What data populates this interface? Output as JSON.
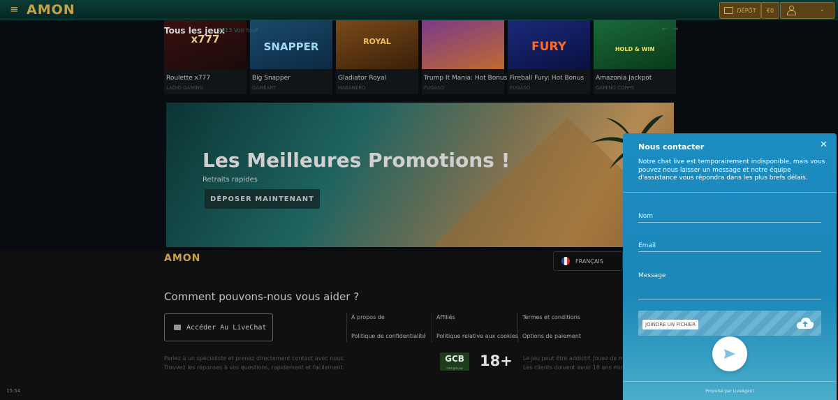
{
  "header": {
    "logo": "AMON",
    "depot_label": "DÉPÔT",
    "balance": "€0"
  },
  "games_section": {
    "title": "Tous les jeux",
    "count_label": "2613 Voir tout",
    "games": [
      {
        "name": "Roulette x777",
        "provider": "LADIO GAMING",
        "thumb_text": "x777",
        "color1": "#3a1010",
        "color2": "#1a0a0a",
        "text_color": "#e8d090"
      },
      {
        "name": "Big Snapper",
        "provider": "GAMEART",
        "thumb_text": "SNAPPER",
        "color1": "#1a4a6a",
        "color2": "#0c2a44",
        "text_color": "#9fd8f5"
      },
      {
        "name": "Gladiator Royal",
        "provider": "HABANERO",
        "thumb_text": "ROYAL",
        "color1": "#7a4a1a",
        "color2": "#3a2008",
        "text_color": "#f0c060"
      },
      {
        "name": "Trump It Mania: Hot Bonus",
        "provider": "FUGASO",
        "thumb_text": "",
        "color1": "#7a3a8a",
        "color2": "#c06a30",
        "text_color": "#ffd060"
      },
      {
        "name": "Fireball Fury: Hot Bonus",
        "provider": "FUGASO",
        "thumb_text": "FURY",
        "color1": "#1a2a7a",
        "color2": "#0a1040",
        "text_color": "#ff6a20"
      },
      {
        "name": "Amazonia Jackpot",
        "provider": "GAMING CORPS",
        "thumb_text": "HOLD & WIN",
        "color1": "#1a6a3a",
        "color2": "#0a3a1a",
        "text_color": "#f0e060"
      }
    ]
  },
  "promo": {
    "title": "Les Meilleures Promotions !",
    "subtitle": "Retraits rapides",
    "button": "DÉPOSER MAINTENANT"
  },
  "footer": {
    "logo": "AMON",
    "language": "FRANÇAIS",
    "help_title": "Comment pouvons-nous vous aider ?",
    "livechat_button": "Accéder Au LiveChat",
    "help_line1": "Parlez à un spécialiste et prenez directement contact avec nous.",
    "help_line2": "Trouvez les réponses à vos questions, rapidement et facilement.",
    "links": {
      "about": "À propos de",
      "privacy": "Politique de confidentialité",
      "affiliates": "Affiliés",
      "cookies": "Politique relative aux cookies",
      "terms": "Termes et conditions",
      "payment": "Options de paiement"
    },
    "gcb_label": "GCB",
    "gcb_sub": "cert.gcb.cw",
    "age_label": "18+",
    "legal_line1": "Le jeu peut être addictif. Jouez de m",
    "legal_line2": "Les clients doivent avoir 18 ans mini"
  },
  "clock": "15:54",
  "chat": {
    "title": "Nous contacter",
    "description": "Notre chat live est temporairement indisponible, mais vous pouvez nous laisser un message et notre équipe d'assistance vous répondra dans les plus brefs délais.",
    "name_label": "Nom",
    "email_label": "Email",
    "message_label": "Message",
    "attach_label": "JOINDRE UN FICHIER",
    "powered_by": "Propulsé par LiveAgent"
  }
}
